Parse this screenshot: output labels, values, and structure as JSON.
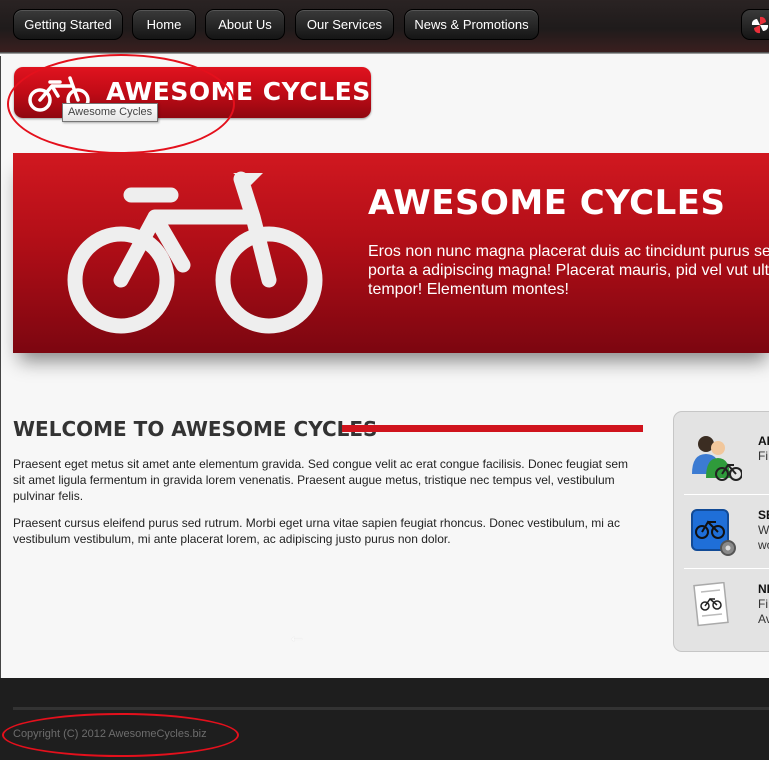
{
  "nav": {
    "items": [
      {
        "label": "Getting Started"
      },
      {
        "label": "Home"
      },
      {
        "label": "About Us"
      },
      {
        "label": "Our Services"
      },
      {
        "label": "News & Promotions"
      }
    ],
    "social_icon": "pinwheel-icon"
  },
  "logo": {
    "text": "AWESOME CYCLES",
    "icon": "bicycle-icon",
    "tooltip": "Awesome Cycles"
  },
  "banner": {
    "title": "AWESOME CYCLES",
    "text": "Eros non nunc magna placerat duis ac tincidunt purus se porta a adipiscing magna! Placerat mauris, pid vel vut ult tempor! Elementum montes!",
    "icon": "bicycle-icon"
  },
  "welcome": {
    "title": "WELCOME TO AWESOME CYCLES",
    "paragraphs": [
      "Praesent eget metus sit amet ante elementum gravida. Sed congue velit ac erat congue facilisis. Donec feugiat sem sit amet ligula fermentum in gravida lorem venenatis. Praesent augue metus, tristique nec tempus vel, vestibulum pulvinar felis.",
      "Praesent cursus eleifend purus sed rutrum. Morbi eget urna vitae sapien feugiat rhoncus. Donec vestibulum, mi ac vestibulum vestibulum, mi ante placerat lorem, ac adipiscing justo purus non dolor."
    ],
    "arrow": "←"
  },
  "sidebar": {
    "items": [
      {
        "title": "AB",
        "lines": [
          "Fi"
        ],
        "icon": "people-bike-icon"
      },
      {
        "title": "SE",
        "lines": [
          "W",
          "wo"
        ],
        "icon": "bike-settings-icon"
      },
      {
        "title": "NI",
        "lines": [
          "Fi",
          "Av"
        ],
        "icon": "document-bike-icon"
      }
    ]
  },
  "footer": {
    "copyright": "Copyright (C) 2012 AwesomeCycles.biz"
  },
  "colors": {
    "brand_red": "#d0141d",
    "nav_dark": "#1f1b1b",
    "footer_bg": "#1e1e1e",
    "annotation_red": "#e4101c"
  }
}
